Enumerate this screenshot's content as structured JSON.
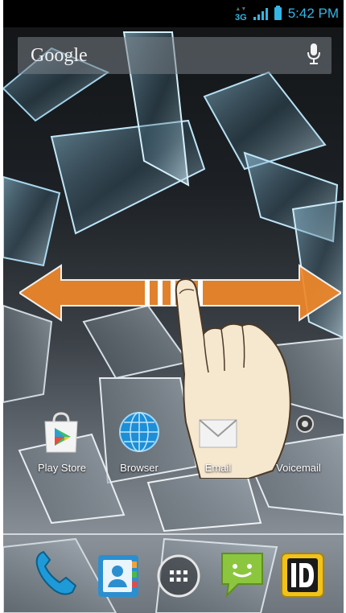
{
  "status_bar": {
    "network_type": "3G",
    "time": "5:42 PM",
    "icons": [
      "network-3g-icon",
      "signal-strength-icon",
      "battery-icon"
    ],
    "accent_color": "#33b5e5"
  },
  "search_widget": {
    "logo_text": "Google",
    "icons": [
      "microphone-icon"
    ]
  },
  "swipe_hint": {
    "icons": [
      "double-arrow-icon",
      "pointing-hand-icon"
    ],
    "arrow_color": "#f0882a"
  },
  "home_apps": [
    {
      "label": "Play Store",
      "icon": "play-store-icon"
    },
    {
      "label": "Browser",
      "icon": "browser-globe-icon"
    },
    {
      "label": "Email",
      "icon": "email-icon"
    },
    {
      "label": "Voicemail",
      "icon": "voicemail-icon"
    }
  ],
  "dock": {
    "items": [
      "phone-icon",
      "contacts-icon",
      "all-apps-icon",
      "messaging-icon",
      "3d-app-icon"
    ]
  }
}
